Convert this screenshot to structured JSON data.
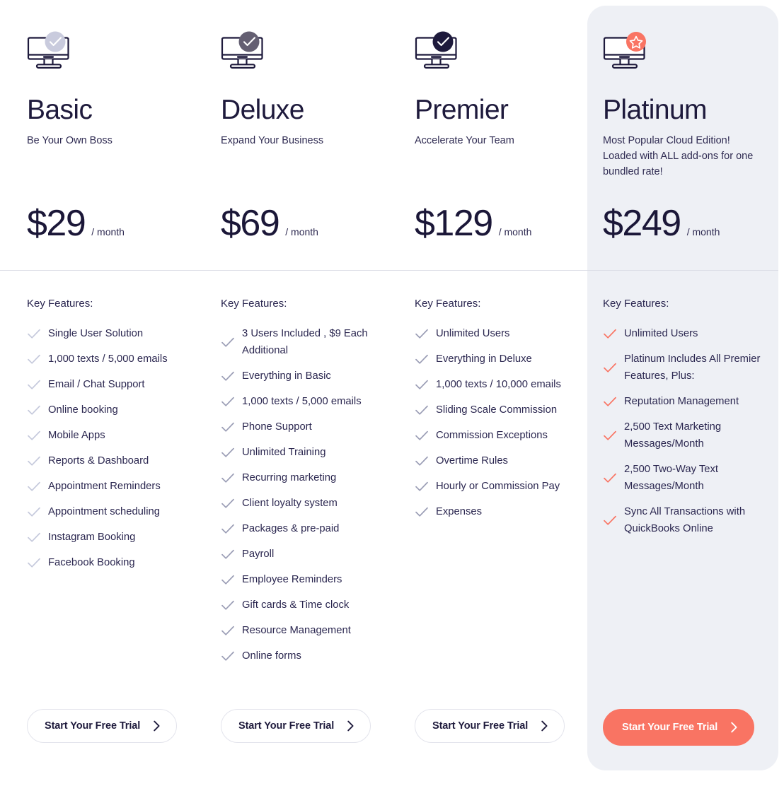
{
  "theme": {
    "accent_color": "#f97463",
    "text_color": "#1e1a3c",
    "featured_background": "#eef0f5",
    "check_muted": "#c5c9dc",
    "check_mid": "#9a9db5"
  },
  "features_heading": "Key Features:",
  "cta_label": "Start Your Free Trial",
  "plans": [
    {
      "id": "basic",
      "icon": "monitor-check-icon",
      "badge_style": "light",
      "name": "Basic",
      "tagline": "Be Your Own Boss",
      "price": "$29",
      "period": "/ month",
      "features": [
        "Single User Solution",
        "1,000 texts / 5,000 emails",
        "Email / Chat Support",
        "Online booking",
        "Mobile Apps",
        "Reports & Dashboard",
        "Appointment Reminders",
        "Appointment scheduling",
        "Instagram Booking",
        "Facebook Booking"
      ]
    },
    {
      "id": "deluxe",
      "icon": "monitor-check-icon",
      "badge_style": "medium",
      "name": "Deluxe",
      "tagline": "Expand Your Business",
      "price": "$69",
      "period": "/ month",
      "features": [
        "3 Users Included , $9 Each Additional",
        "Everything in Basic",
        "1,000 texts / 5,000 emails",
        "Phone Support",
        "Unlimited Training",
        "Recurring marketing",
        "Client loyalty system",
        "Packages & pre-paid",
        "Payroll",
        "Employee Reminders",
        "Gift cards & Time clock",
        "Resource Management",
        "Online forms"
      ]
    },
    {
      "id": "premier",
      "icon": "monitor-check-icon",
      "badge_style": "dark",
      "name": "Premier",
      "tagline": "Accelerate Your Team",
      "price": "$129",
      "period": "/ month",
      "features": [
        "Unlimited Users",
        "Everything in Deluxe",
        "1,000 texts / 10,000 emails",
        "Sliding Scale Commission",
        "Commission Exceptions",
        "Overtime Rules",
        "Hourly or Commission Pay",
        "Expenses"
      ]
    },
    {
      "id": "platinum",
      "icon": "monitor-star-icon",
      "badge_style": "accent",
      "name": "Platinum",
      "tagline": "Most Popular Cloud Edition! Loaded with ALL add-ons for one bundled rate!",
      "price": "$249",
      "period": "/ month",
      "features": [
        "Unlimited Users",
        "Platinum Includes All Premier Features, Plus:",
        "Reputation Management",
        "2,500 Text Marketing Messages/Month",
        "2,500 Two-Way Text Messages/Month",
        "Sync All Transactions with QuickBooks Online"
      ]
    }
  ]
}
